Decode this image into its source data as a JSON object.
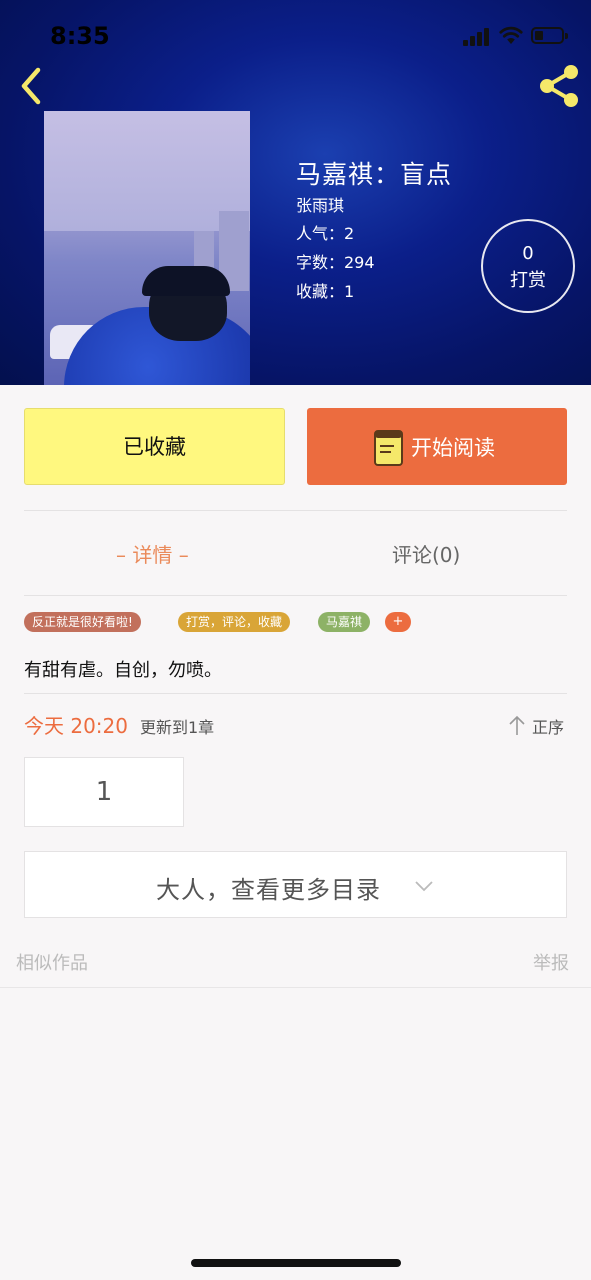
{
  "status_bar": {
    "time": "8:35"
  },
  "book": {
    "title": "马嘉祺：盲点",
    "author": "张雨琪",
    "popularity": "人气：2",
    "word_count": "字数：294",
    "favorites": "收藏：1"
  },
  "tip": {
    "count": "0",
    "label": "打赏"
  },
  "actions": {
    "collected_label": "已收藏",
    "read_label": "开始阅读"
  },
  "tabs": {
    "detail": "– 详情 –",
    "comments": "评论(0)"
  },
  "tags": [
    {
      "label": "反正就是很好看啦!",
      "color": "#c2705c"
    },
    {
      "label": "打赏，评论，收藏",
      "color": "#d9a537"
    },
    {
      "label": "马嘉祺",
      "color": "#8db266"
    }
  ],
  "tag_add": "+",
  "synopsis": "有甜有虐。自创，勿喷。",
  "update": {
    "time": "今天 20:20",
    "text": "更新到1章",
    "sort_label": "正序"
  },
  "chapters": [
    "1"
  ],
  "more_catalog": "大人，查看更多目录",
  "footer": {
    "similar": "相似作品",
    "report": "举报"
  },
  "colors": {
    "accent": "#ec6c3f",
    "collected_bg": "#fff87f",
    "icon_yellow": "#f5e86a"
  }
}
